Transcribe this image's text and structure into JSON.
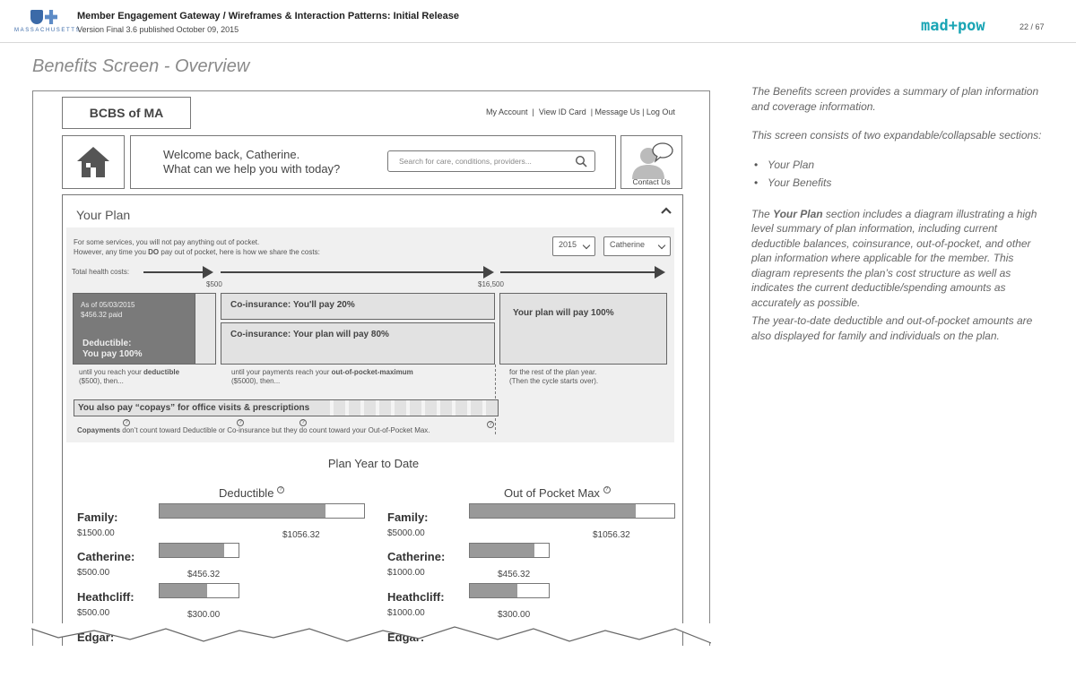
{
  "header": {
    "logo_text": "MASSACHUSETTS",
    "doc_title": "Member Engagement Gateway / Wireframes & Interaction Patterns: Initial Release",
    "doc_version": "Version Final 3.6 published October 09, 2015",
    "brand": "mad+pow",
    "page_indicator": "22 / 67"
  },
  "screen_title": "Benefits Screen - Overview",
  "notes": {
    "p1": "The Benefits screen provides a summary of plan information and coverage information.",
    "p2": "This screen consists of two expandable/collapsable sections:",
    "items": [
      "Your Plan",
      "Your Benefits"
    ],
    "p3_prefix": "The ",
    "p3_bold": "Your Plan",
    "p3_rest": " section includes a diagram illustrating a high level summary of plan information, including current deductible balances, coinsurance, out-of-pocket, and other plan information where applicable for the member. This diagram represents the plan’s cost structure as well as indicates the current deductible/spending amounts as accurately as possible.",
    "p4": "The year-to-date deductible and out-of-pocket amounts are also displayed for family and individuals on the plan."
  },
  "app": {
    "brand": "BCBS of MA",
    "top_links": "My Account  |  View ID Card  | Message Us | Log Out",
    "welcome_line1": "Welcome back, Catherine.",
    "welcome_line2": "What can we help you with today?",
    "search_placeholder": "Search for care, conditions, providers...",
    "contact_label": "Contact Us"
  },
  "plan": {
    "title": "Your Plan",
    "intro1": "For some services, you will not pay anything out of pocket.",
    "intro2_a": "However, any time you ",
    "intro2_bold": "DO",
    "intro2_b": " pay out of pocket, here is how we share the costs:",
    "year_select": "2015",
    "member_select": "Catherine",
    "total_label": "Total health costs:",
    "marker1": "$500",
    "marker2": "$16,500",
    "asof": "As of 05/03/2015",
    "paid": "$456.32 paid",
    "deductible_l1": "Deductible:",
    "deductible_l2": "You pay 100%",
    "coins1": "Co-insurance:   You'll pay 20%",
    "coins2": "Co-insurance:   Your plan will pay 80%",
    "plan100": "Your plan will pay 100%",
    "note1_a": "until you reach your ",
    "note1_b": "deductible",
    "note1_c": "($500), then...",
    "note2_a": "until your payments reach your ",
    "note2_b": "out-of-pocket-maximum",
    "note2_c": "($5000), then...",
    "note3_a": "for the rest of the plan year.",
    "note3_b": "(Then the cycle starts over).",
    "copays": "You also pay “copays” for office visits & prescriptions",
    "copay_note_bold": "Copayments",
    "copay_note": " don’t count toward Deductible or Co-insurance but they do count toward your Out-of-Pocket Max."
  },
  "ytd": {
    "title": "Plan Year to Date",
    "left_title": "Deductible",
    "right_title": "Out of Pocket Max",
    "left": [
      {
        "name": "Family:",
        "total": "$1500.00",
        "spent": "$1056.32",
        "fill": 0.81
      },
      {
        "name": "Catherine:",
        "total": "$500.00",
        "spent": "$456.32",
        "fill": 0.82
      },
      {
        "name": "Heathcliff:",
        "total": "$500.00",
        "spent": "$300.00",
        "fill": 0.6
      },
      {
        "name": "Edgar:"
      }
    ],
    "right": [
      {
        "name": "Family:",
        "total": "$5000.00",
        "spent": "$1056.32",
        "fill": 0.81
      },
      {
        "name": "Catherine:",
        "total": "$1000.00",
        "spent": "$456.32",
        "fill": 0.82
      },
      {
        "name": "Heathcliff:",
        "total": "$1000.00",
        "spent": "$300.00",
        "fill": 0.6
      },
      {
        "name": "Edgar:"
      }
    ]
  }
}
